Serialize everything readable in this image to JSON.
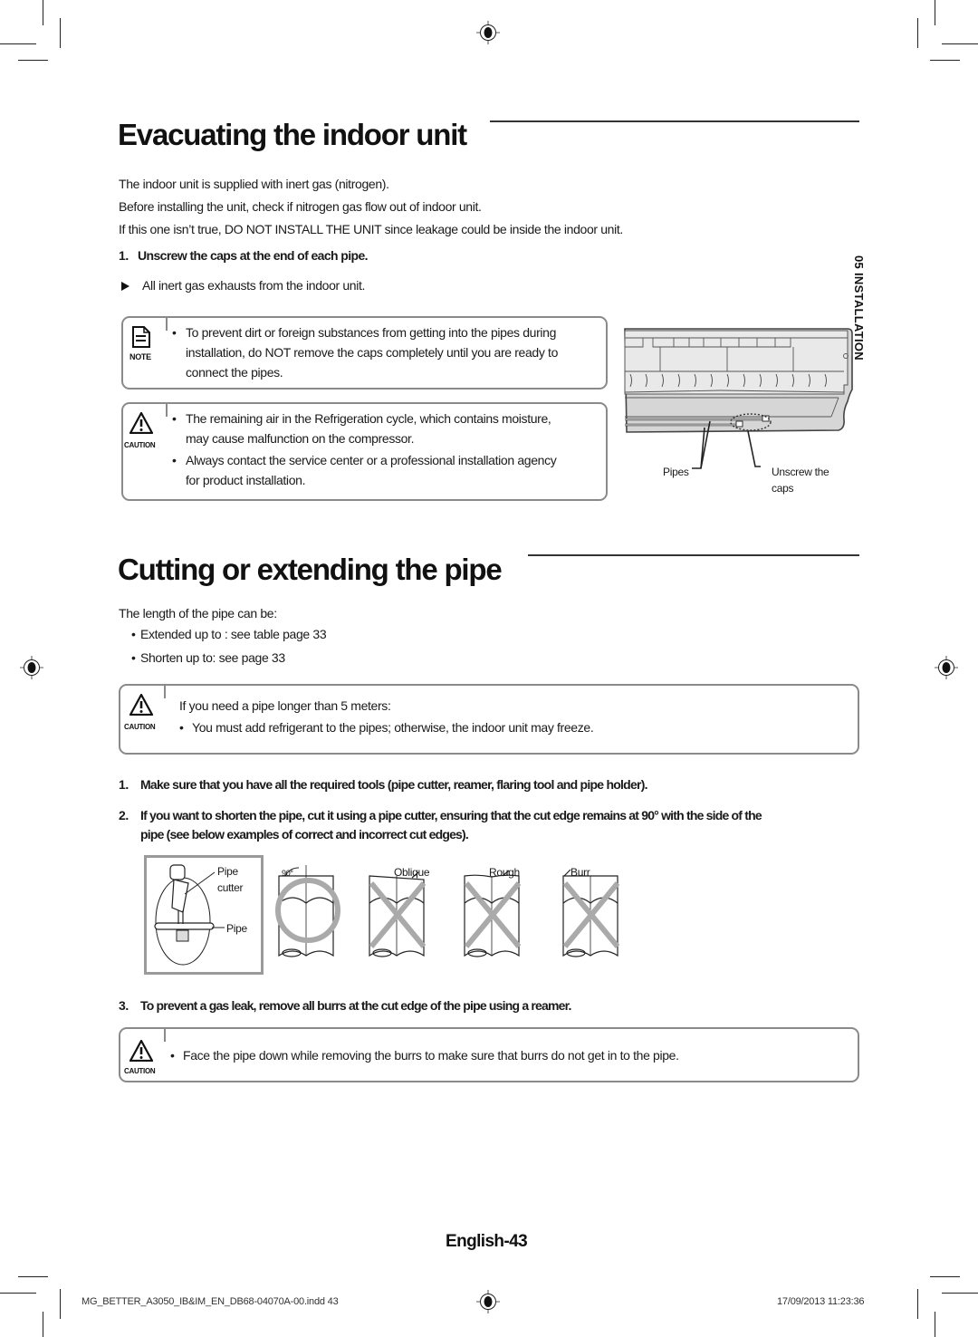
{
  "section1": {
    "title": "Evacuating the indoor unit",
    "intro": [
      "The indoor unit is supplied with inert gas  (nitrogen).",
      "Before installing the unit, check if nitrogen gas flow out of indoor unit.",
      "If this one isn’t true, DO NOT INSTALL THE UNIT since leakage could be inside the indoor unit."
    ],
    "step1_num": "1.",
    "step1": "Unscrew the caps at the end of each pipe.",
    "result_bullet": "All inert gas exhausts from the indoor unit.",
    "note": {
      "icon_label": "NOTE",
      "lines": [
        "To prevent dirt or foreign substances from getting into the pipes during",
        "installation, do NOT remove the caps completely until you are ready to",
        "connect the pipes."
      ]
    },
    "caution": {
      "icon_label": "CAUTION",
      "bullet1": [
        "The remaining air in the Refrigeration cycle, which contains moisture,",
        "may cause malfunction on the compressor."
      ],
      "bullet2": [
        "Always contact the service center or a professional installation agency",
        "for product installation."
      ]
    },
    "figure": {
      "label_pipes": "Pipes",
      "label_caps_1": "Unscrew the",
      "label_caps_2": "caps"
    }
  },
  "side_tab": "05  INSTALLATION",
  "section2": {
    "title": "Cutting or extending the pipe",
    "intro": "The length of the pipe can be:",
    "bullets": [
      "Extended up to : see table page 33",
      "Shorten up to: see page 33"
    ],
    "caution1": {
      "icon_label": "CAUTION",
      "heading": "If you need a pipe longer than 5 meters:",
      "bullet": "You must add refrigerant to the pipes; otherwise, the indoor unit may freeze."
    },
    "steps": [
      {
        "num": "1.",
        "text": "Make sure that you have all the required tools (pipe cutter, reamer, flaring tool and pipe holder)."
      },
      {
        "num": "2.",
        "text": "If you want to shorten the pipe, cut it using a pipe cutter, ensuring that the cut edge remains at 90° with the side of the",
        "text2": "pipe (see below examples of correct and incorrect cut edges)."
      },
      {
        "num": "3.",
        "text": "To prevent a gas leak, remove all burrs at the cut edge of the pipe using a reamer."
      }
    ],
    "figure": {
      "pipe_cutter_1": "Pipe",
      "pipe_cutter_2": "cutter",
      "pipe": "Pipe",
      "angle": "90°",
      "oblique": "Oblique",
      "rough": "Rough",
      "burr": "Burr"
    },
    "caution2": {
      "icon_label": "CAUTION",
      "bullet": "Face the pipe down while removing the burrs to make sure that burrs do not get in to the pipe."
    }
  },
  "page_number": "English-43",
  "footer": {
    "file": "MG_BETTER_A3050_IB&IM_EN_DB68-04070A-00.indd   43",
    "datetime": "17/09/2013   11:23:36"
  }
}
